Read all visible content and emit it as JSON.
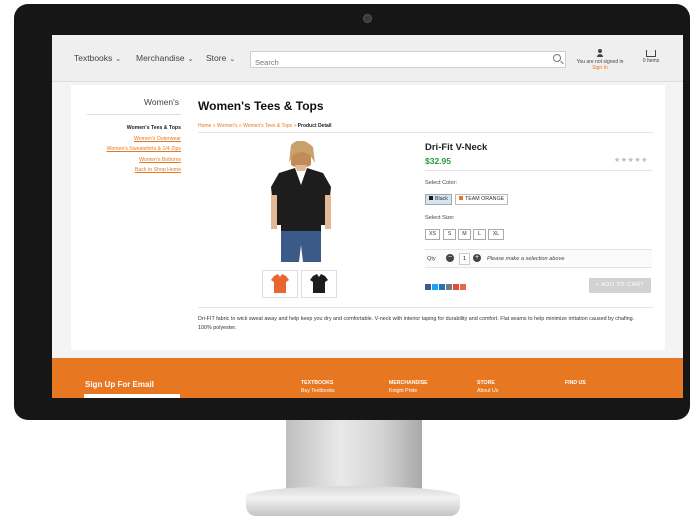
{
  "nav": {
    "items": [
      "Textbooks",
      "Merchandise",
      "Store"
    ],
    "search_placeholder": "Search",
    "account_line1": "You are not signed in",
    "account_line2": "Sign In",
    "cart_label": "0 Items"
  },
  "sidebar": {
    "title": "Women's",
    "items": [
      "Women's Tees & Tops",
      "Women's Outerwear",
      "Women's Sweatshirts & 1/4 Zips",
      "Women's Bottoms",
      "Back to Shop Home"
    ]
  },
  "page": {
    "title": "Women's Tees & Tops",
    "breadcrumb": [
      "Home",
      "Women's",
      "Women's Tees & Tops"
    ],
    "breadcrumb_current": "Product Detail"
  },
  "product": {
    "name": "Dri-Fit V-Neck",
    "price": "$32.95",
    "rating_stars": "★★★★★",
    "rating": 0,
    "select_color_label": "Select Color:",
    "colors": [
      {
        "label": "Black",
        "swatch": "#1a1a1a"
      },
      {
        "label": "TEAM ORANGE",
        "swatch": "#e87722"
      }
    ],
    "select_size_label": "Select Size:",
    "sizes": [
      "XS",
      "S",
      "M",
      "L",
      "XL"
    ],
    "qty_label": "Qty",
    "qty_value": "1",
    "qty_message": "Please make a selection above",
    "add_to_cart": "+ ADD TO CART",
    "description": "Dri-FIT fabric to wick sweat away and help keep you dry and comfortable. V-neck with interior taping for durability and comfort. Flat seams to help minimize irritation caused by chafing. 100% polyester."
  },
  "share_icons": [
    {
      "name": "facebook-icon",
      "color": "#3b5998"
    },
    {
      "name": "twitter-icon",
      "color": "#1da1f2"
    },
    {
      "name": "pinterest-icon",
      "color": "#1e73be"
    },
    {
      "name": "email-icon",
      "color": "#777777"
    },
    {
      "name": "google-plus-icon",
      "color": "#dd4b39"
    },
    {
      "name": "share-plus-icon",
      "color": "#e8674a"
    }
  ],
  "footer": {
    "signup_title": "Sign Up For Email",
    "columns": [
      {
        "heading": "TEXTBOOKS",
        "link": "Buy Textbooks"
      },
      {
        "heading": "MERCHANDISE",
        "link": "Knight Pride"
      },
      {
        "heading": "STORE",
        "link": "About Us"
      },
      {
        "heading": "FIND US",
        "link": ""
      }
    ]
  },
  "colors": {
    "accent": "#e87722",
    "price_green": "#2e9a3d",
    "bezel": "#161616"
  }
}
